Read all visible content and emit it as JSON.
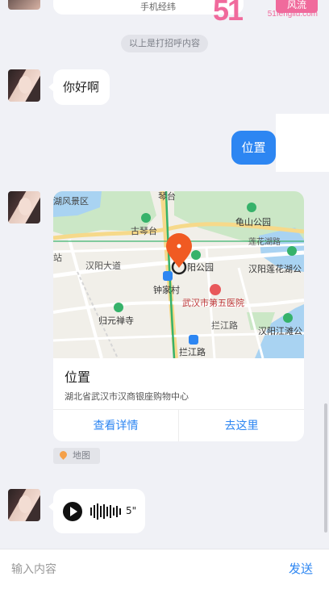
{
  "top_bubble": {
    "text": "手机经纬"
  },
  "watermark": {
    "number": "51",
    "tag": "风流",
    "url": "51fengliu.com"
  },
  "system_notice": "以上是打招呼内容",
  "greeting": "你好啊",
  "location_button": "位置",
  "map_card": {
    "title": "位置",
    "address": "湖北省武汉市汉商银座购物中心",
    "view_details": "查看详情",
    "go_here": "去这里",
    "poi": {
      "p1": "湖风景区",
      "p2": "琴台",
      "p3": "古琴台",
      "p4": "龟山公园",
      "p5": "莲花湖路",
      "p6": "汉阳莲花湖公",
      "p7": "汉阳大道",
      "p8": "阳公园",
      "p9": "钟家村",
      "p10": "武汉市第五医院",
      "p11": "归元禅寺",
      "p12": "拦江路",
      "p13": "汉阳江滩公",
      "p14": "拦江路",
      "p15": "站"
    }
  },
  "map_tag": "地图",
  "voice_duration": "5\"",
  "input": {
    "placeholder": "输入内容",
    "send_label": "发送"
  },
  "colors": {
    "accent": "#2d86f2",
    "background": "#f0f1f6",
    "marker": "#f05a22"
  }
}
